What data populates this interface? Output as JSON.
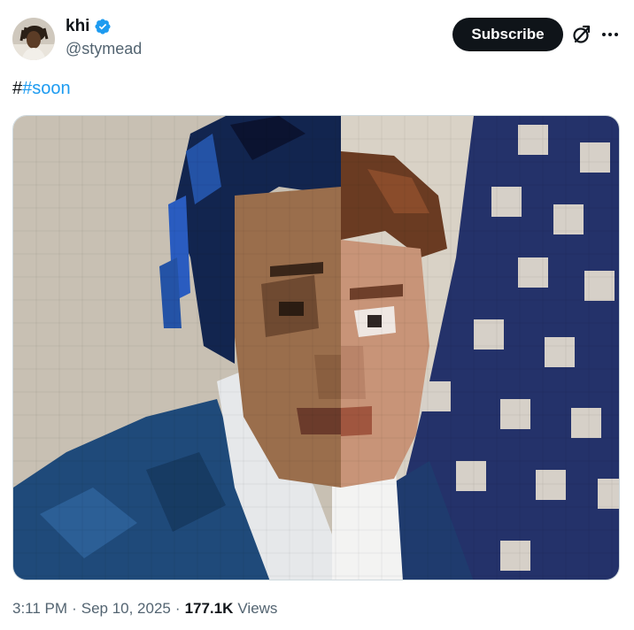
{
  "author": {
    "display_name": "khi",
    "handle": "@stymead",
    "verified": true,
    "verified_color": "#1d9bf0"
  },
  "actions": {
    "subscribe_label": "Subscribe",
    "grok_icon": "grok-icon",
    "more_icon": "more-horizontal-icon"
  },
  "tweet": {
    "text_prefix": "#",
    "hashtag": "#soon",
    "hashtag_color": "#1d9bf0"
  },
  "media": {
    "alt": "pixelated split portrait"
  },
  "footer": {
    "time": "3:11 PM",
    "separator": "·",
    "date": "Sep 10, 2025",
    "views_count": "177.1K",
    "views_label": "Views"
  }
}
